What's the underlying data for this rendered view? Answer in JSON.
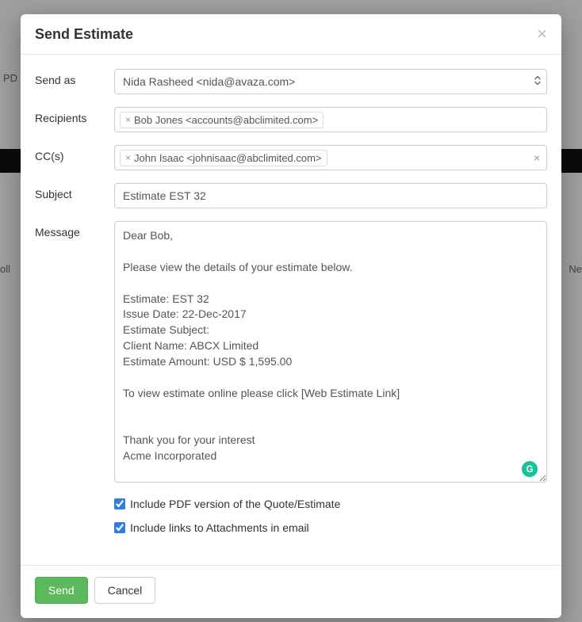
{
  "modal": {
    "title": "Send Estimate",
    "close_glyph": "×"
  },
  "labels": {
    "send_as": "Send as",
    "recipients": "Recipients",
    "ccs": "CC(s)",
    "subject": "Subject",
    "message": "Message"
  },
  "send_as": {
    "selected": "Nida Rasheed <nida@avaza.com>"
  },
  "recipients": {
    "tags": [
      "Bob Jones <accounts@abclimited.com>"
    ]
  },
  "ccs": {
    "tags": [
      "John Isaac <johnisaac@abclimited.com>"
    ]
  },
  "subject": {
    "value": "Estimate EST 32"
  },
  "message": {
    "value": "Dear Bob,\n\nPlease view the details of your estimate below.\n\nEstimate: EST 32\nIssue Date: 22-Dec-2017\nEstimate Subject:\nClient Name: ABCX Limited\nEstimate Amount: USD $ 1,595.00\n\nTo view estimate online please click [Web Estimate Link]\n\n\nThank you for your interest\nAcme Incorporated"
  },
  "options": {
    "include_pdf": {
      "label": "Include PDF version of the Quote/Estimate",
      "checked": true
    },
    "include_attachments": {
      "label": "Include links to Attachments in email",
      "checked": true
    }
  },
  "footer": {
    "send": "Send",
    "cancel": "Cancel"
  },
  "grammarly_glyph": "G",
  "background": {
    "left_text": "oll",
    "right_text": "Ne",
    "pd_text": "PD"
  }
}
